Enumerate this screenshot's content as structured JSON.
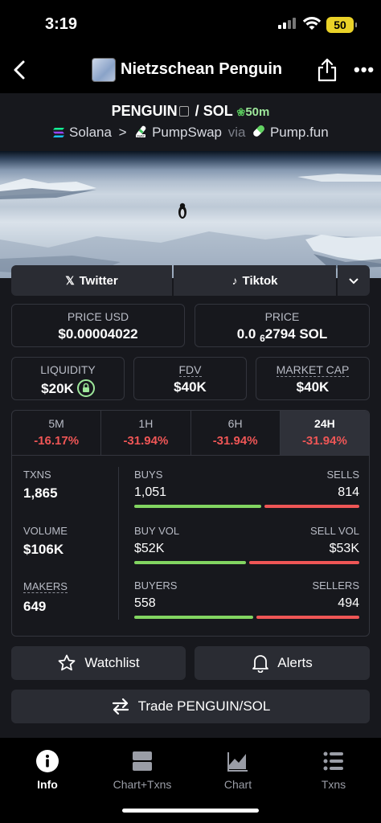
{
  "status_bar": {
    "time": "3:19",
    "battery": "50"
  },
  "nav": {
    "title": "Nietzschean Penguin"
  },
  "pair": {
    "base": "PENGUIN",
    "sep": "/",
    "quote": "SOL",
    "age": "50m"
  },
  "chain": {
    "name": "Solana",
    "dex": "PumpSwap",
    "via": "via",
    "launchpad": "Pump.fun"
  },
  "social": {
    "twitter": "Twitter",
    "tiktok": "Tiktok"
  },
  "price_usd": {
    "label": "PRICE USD",
    "value": "$0.00004022"
  },
  "price_native": {
    "label": "PRICE",
    "prefix": "0.0",
    "zeros": "6",
    "digits": "2794 SOL"
  },
  "liquidity": {
    "label": "LIQUIDITY",
    "value": "$20K"
  },
  "fdv": {
    "label": "FDV",
    "value": "$40K"
  },
  "market_cap": {
    "label": "MARKET CAP",
    "value": "$40K"
  },
  "timeframes": [
    {
      "label": "5M",
      "change": "-16.17%"
    },
    {
      "label": "1H",
      "change": "-31.94%"
    },
    {
      "label": "6H",
      "change": "-31.94%"
    },
    {
      "label": "24H",
      "change": "-31.94%"
    }
  ],
  "stats": {
    "txns": {
      "label": "TXNS",
      "value": "1,865"
    },
    "volume": {
      "label": "VOLUME",
      "value": "$106K"
    },
    "makers": {
      "label": "MAKERS",
      "value": "649"
    },
    "buys": {
      "label": "BUYS",
      "value": "1,051",
      "share": 0.5636
    },
    "sells": {
      "label": "SELLS",
      "value": "814"
    },
    "buy_vol": {
      "label": "BUY VOL",
      "value": "$52K",
      "share": 0.495
    },
    "sell_vol": {
      "label": "SELL VOL",
      "value": "$53K"
    },
    "buyers": {
      "label": "BUYERS",
      "value": "558",
      "share": 0.53
    },
    "sellers": {
      "label": "SELLERS",
      "value": "494"
    }
  },
  "actions": {
    "watchlist": "Watchlist",
    "alerts": "Alerts",
    "trade": "Trade PENGUIN/SOL"
  },
  "tabbar": [
    {
      "label": "Info",
      "icon": "info-icon",
      "active": true
    },
    {
      "label": "Chart+Txns",
      "icon": "chart-txns-icon",
      "active": false
    },
    {
      "label": "Chart",
      "icon": "chart-icon",
      "active": false
    },
    {
      "label": "Txns",
      "icon": "list-icon",
      "active": false
    }
  ],
  "colors": {
    "positive": "#82d561",
    "negative": "#ef5656",
    "accent_green": "#9ee89b",
    "surface": "#17181d",
    "button": "#2a2c33"
  }
}
